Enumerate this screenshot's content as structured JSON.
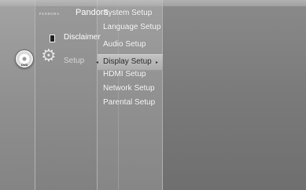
{
  "sidebar": {
    "disc": {
      "label": "DVD",
      "icon": "dvd-disc-icon"
    },
    "items": [
      {
        "label": "Pandora",
        "logo_text": "PANDORA",
        "icon": "pandora-logo"
      },
      {
        "label": "Disclaimer",
        "icon": "document-icon"
      },
      {
        "label": "Setup",
        "icon": "gear-icon",
        "selected": true
      }
    ]
  },
  "setup_menu": {
    "items": [
      {
        "label": "System Setup"
      },
      {
        "label": "Language Setup"
      },
      {
        "label": "Audio Setup"
      },
      {
        "label": "Display Setup",
        "selected": true
      },
      {
        "label": "HDMI Setup"
      },
      {
        "label": "Network Setup"
      },
      {
        "label": "Parental Setup"
      }
    ],
    "highlight_color": "#b8b8b8"
  },
  "colors": {
    "background": "#8a8a8a",
    "text": "#ffffff",
    "selected_text": "#222222"
  }
}
